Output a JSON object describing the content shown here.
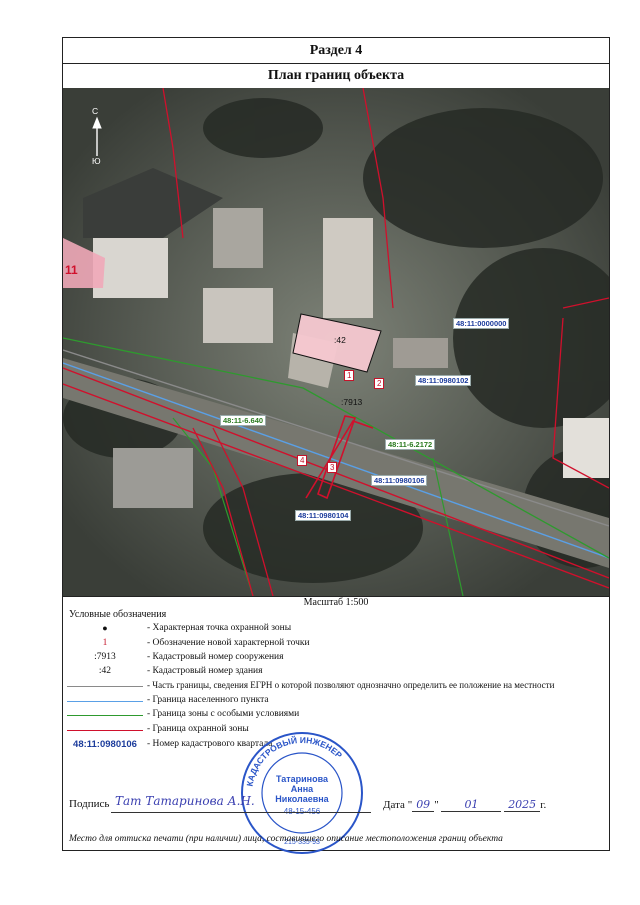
{
  "header": {
    "section": "Раздел 4",
    "title": "План границ объекта"
  },
  "map": {
    "north": "С",
    "south": "Ю",
    "labels": {
      "q0000000": "48:11:0000000",
      "q0980102": "48:11:0980102",
      "q0980106": "48:11:0980106",
      "q0980104": "48:11:0980104",
      "zone_a": "48:11-6.640",
      "zone_b": "48:11-6.2172",
      "building": ":42",
      "structure": ":7913",
      "parcel_edge": "11"
    },
    "points": [
      "1",
      "2",
      "3",
      "4"
    ]
  },
  "scale": "Масштаб 1:500",
  "legend": {
    "title": "Условные обозначения",
    "rows": [
      {
        "symbol": "●",
        "text": "- Характерная точка охранной зоны"
      },
      {
        "symbol": "1",
        "text": "- Обозначение новой характерной точки"
      },
      {
        "symbol": ":7913",
        "text": "- Кадастровый номер сооружения"
      },
      {
        "symbol": ":42",
        "text": "- Кадастровый номер здания"
      },
      {
        "symbol": "",
        "text": "- Часть границы, сведения ЕГРН о которой позволяют однозначно определить ее положение на местности"
      },
      {
        "symbol": "",
        "text": "- Граница населенного пункта"
      },
      {
        "symbol": "",
        "text": "- Граница зоны с особыми условиями"
      },
      {
        "symbol": "",
        "text": "- Граница охранной зоны"
      },
      {
        "symbol": "48:11:0980106",
        "text": "- Номер кадастрового квартала"
      }
    ]
  },
  "colors": {
    "bound_egrn": "#8a8a8a",
    "bound_settlement": "#5aa0e6",
    "bound_special": "#2e9a2e",
    "bound_protect": "#d0102c",
    "stamp": "#2a55c8"
  },
  "signature": {
    "label": "Подпись",
    "handwriting": "Тат Татаринова А.Н.",
    "date_label": "Дата",
    "date_day": "09",
    "date_month": "01",
    "date_year": "2025",
    "date_suffix": "г."
  },
  "stamp": {
    "ring_top": "КАДАСТРОВЫЙ ИНЖЕНЕР",
    "name1": "Татаринова",
    "name2": "Анна",
    "name3": "Николаевна",
    "reg": "48-15-456",
    "phone": "215-335-93"
  },
  "footer": "Место для оттиска печати (при наличии) лица, составившего описание местоположения границ объекта"
}
